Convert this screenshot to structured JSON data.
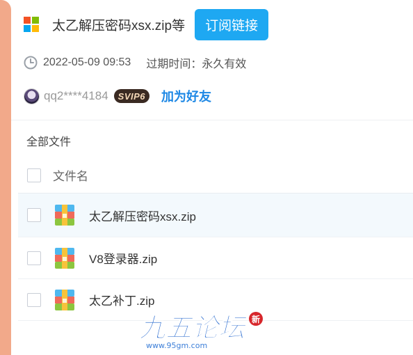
{
  "share": {
    "title": "太乙解压密码xsx.zip等",
    "subscribe_label": "订阅链接",
    "date": "2022-05-09 09:53",
    "expire": "过期时间：永久有效"
  },
  "user": {
    "name": "qq2****4184",
    "vip": "SVIP6",
    "add_friend": "加为好友"
  },
  "breadcrumb": "全部文件",
  "table": {
    "header": "文件名",
    "files": [
      {
        "name": "太乙解压密码xsx.zip"
      },
      {
        "name": "V8登录器.zip"
      },
      {
        "name": "太乙补丁.zip"
      }
    ]
  },
  "watermark": {
    "name": "九五论坛",
    "url": "www.95gm.com",
    "seal": "新"
  },
  "colors": {
    "accent": "#1ea8f2",
    "link": "#1e88e5",
    "side_bar": "#f2a98a",
    "selected_row": "#f3f9fd"
  }
}
